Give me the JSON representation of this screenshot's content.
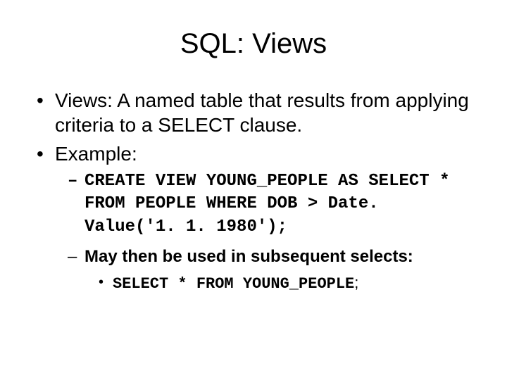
{
  "title": "SQL: Views",
  "bullets": {
    "b1": "Views: A named table that results from applying criteria to a SELECT clause.",
    "b2": "Example:",
    "sub1": "CREATE VIEW YOUNG_PEOPLE AS SELECT * FROM PEOPLE WHERE DOB > Date. Value('1. 1. 1980');",
    "sub2": "May then be used in subsequent selects:",
    "sub2a_code": "SELECT * FROM YOUNG_PEOPLE",
    "sub2a_tail": ";"
  }
}
